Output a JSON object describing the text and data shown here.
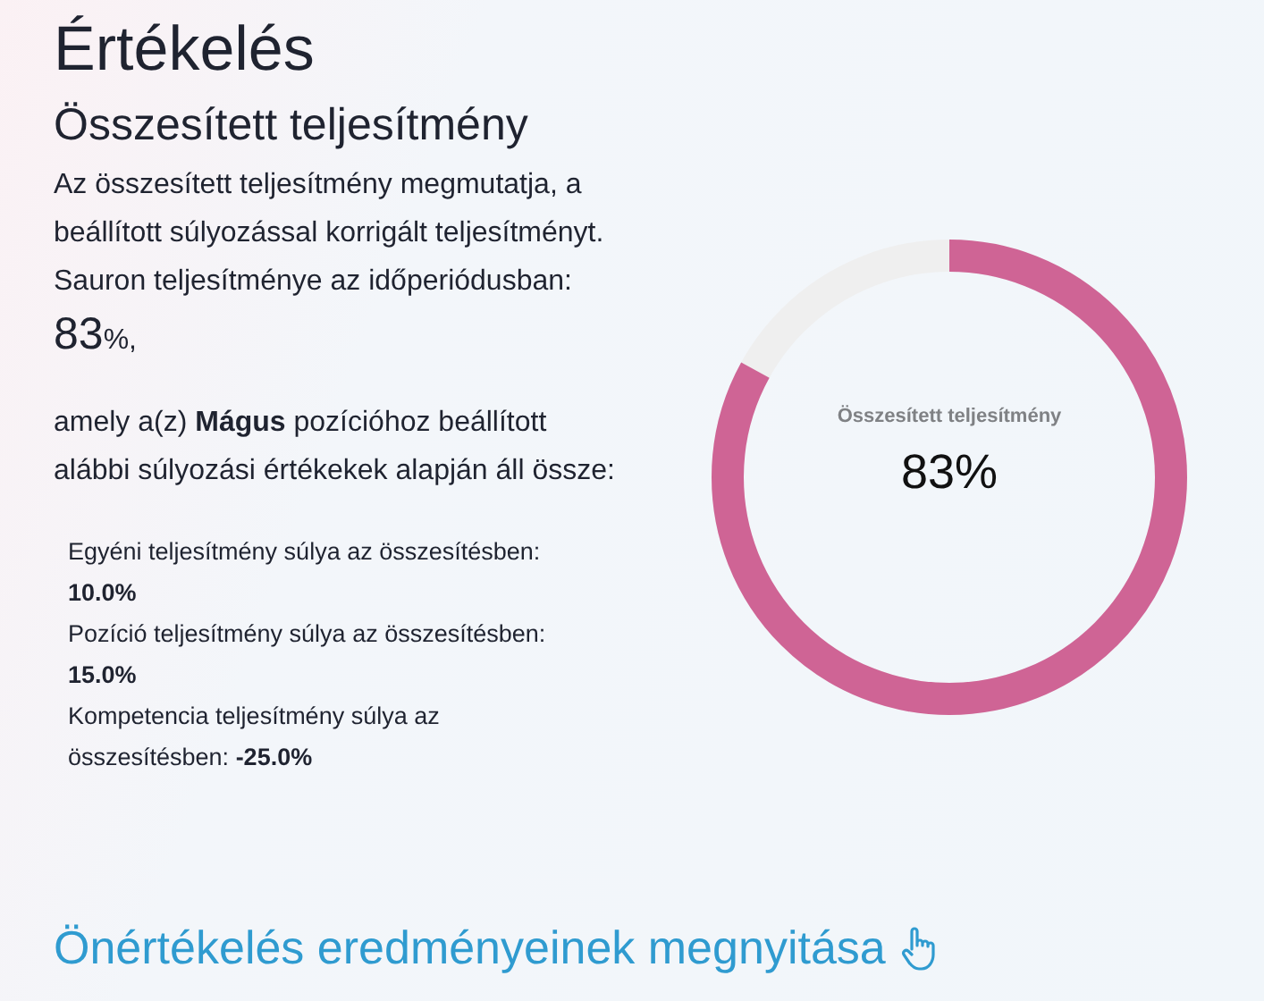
{
  "title": "Értékelés",
  "section": {
    "heading": "Összesített teljesítmény",
    "description": "Az összesített teljesítmény megmutatja, a beállított súlyozással korrigált teljesítményt.",
    "period_label": "Sauron teljesítménye az időperiódusban:",
    "score_value": "83",
    "score_suffix": "%,",
    "composition_note": "amely a(z) **Mágus** pozícióhoz beállított alábbi súlyozási értékekek alapján áll össze:",
    "weights": [
      {
        "text": "Egyéni teljesítmény súlya az összesítésben: **10.0%**"
      },
      {
        "text": "Pozíció teljesítmény súlya az összesítésben: **15.0%**"
      },
      {
        "text": "Kompetencia teljesítmény súlya az összesítésben: **-25.0%**"
      }
    ]
  },
  "gauge": {
    "label": "Összesített teljesítmény",
    "reading": "83%"
  },
  "link": {
    "label": "Önértékelés eredményeinek megnyitása"
  }
}
